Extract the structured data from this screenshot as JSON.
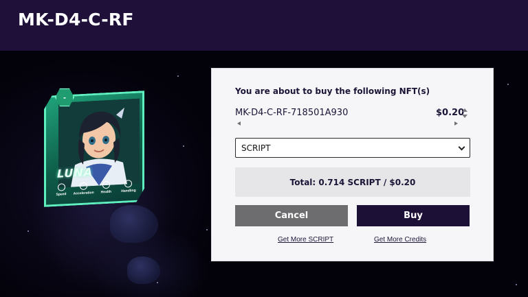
{
  "header": {
    "title": "MK-D4-C-RF"
  },
  "card": {
    "name": "LUNA",
    "badge": "-",
    "stats": [
      {
        "label": "Speed",
        "icon": "lightning-icon"
      },
      {
        "label": "Acceleration",
        "icon": "speedometer-icon"
      },
      {
        "label": "Health",
        "icon": "shield-icon"
      },
      {
        "label": "Handling",
        "icon": "steering-wheel-icon"
      }
    ]
  },
  "modal": {
    "heading": "You are about to buy the following NFT(s)",
    "nft_id": "MK-D4-C-RF-718501A930",
    "price": "$0.20",
    "currency_selected": "SCRIPT",
    "total": "Total: 0.714 SCRIPT / $0.20",
    "cancel_label": "Cancel",
    "buy_label": "Buy",
    "link_script": "Get More SCRIPT",
    "link_credits": "Get More Credits"
  },
  "colors": {
    "header_bg": "#1e1038",
    "buy_button": "#1d1036",
    "cancel_button": "#6d6d6f",
    "card_accent": "#5ff0c0"
  }
}
